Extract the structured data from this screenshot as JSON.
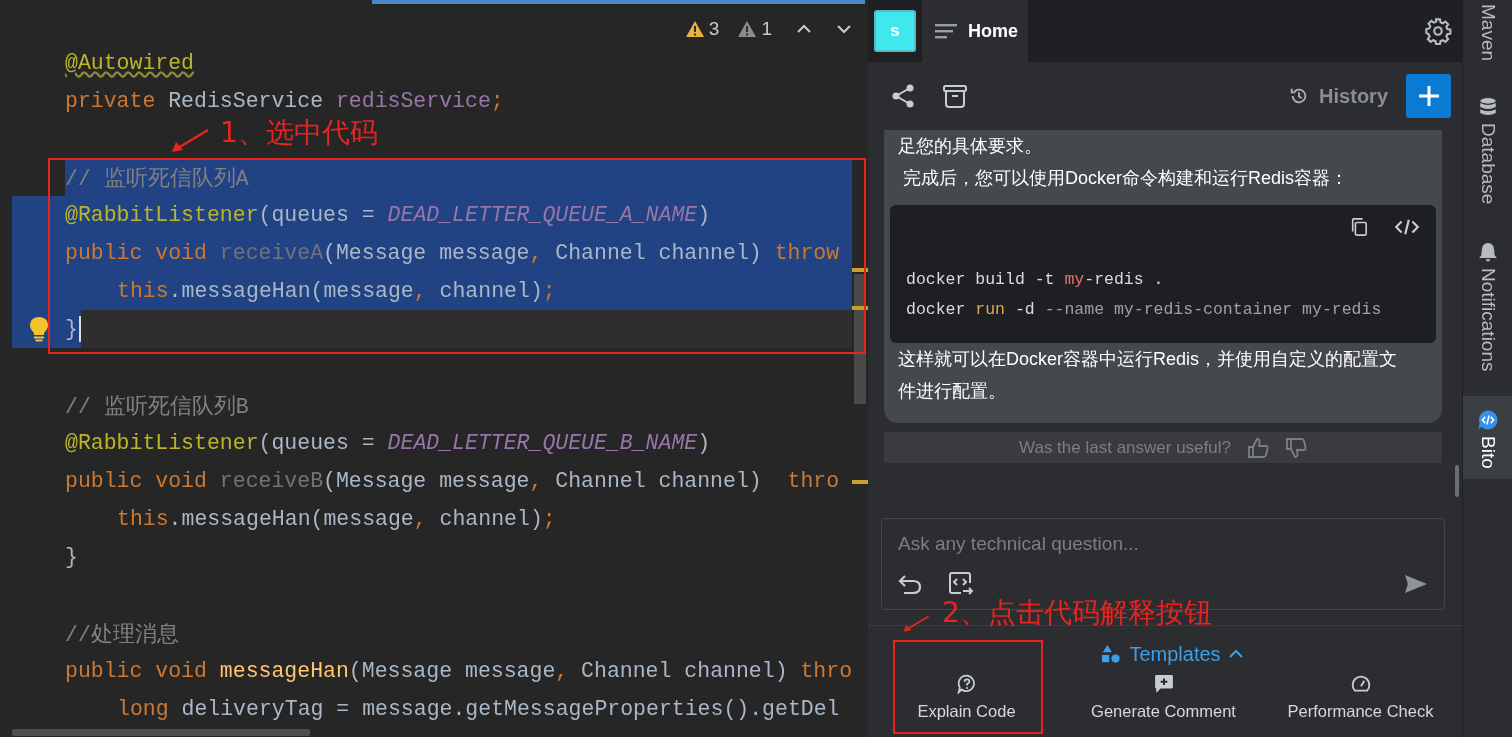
{
  "editor": {
    "inspections": [
      {
        "kind": "warning",
        "count": "3"
      },
      {
        "kind": "weak",
        "count": "1"
      }
    ],
    "lines": [
      {
        "kind": "top",
        "selected": false,
        "tokens": [
          {
            "kind": "annw",
            "t": "@Autowired"
          }
        ]
      },
      {
        "kind": "top",
        "selected": false,
        "tokens": [
          {
            "kind": "kw",
            "t": "private "
          },
          {
            "kind": "plain",
            "t": "RedisService "
          },
          {
            "kind": "field",
            "t": "redisService"
          },
          {
            "kind": "punct",
            "t": ";"
          }
        ]
      },
      {
        "kind": "blank",
        "selected": false
      },
      {
        "kind": "top",
        "selected": true,
        "tokens": [
          {
            "kind": "comment",
            "t": "// 监听死信队列A"
          }
        ]
      },
      {
        "kind": "top",
        "selected": true,
        "tokens": [
          {
            "kind": "ann",
            "t": "@RabbitListener"
          },
          {
            "kind": "plain",
            "t": "(queues = "
          },
          {
            "kind": "const",
            "t": "DEAD_LETTER_QUEUE_A_NAME"
          },
          {
            "kind": "plain",
            "t": ")"
          }
        ]
      },
      {
        "kind": "top",
        "selected": true,
        "tokens": [
          {
            "kind": "kw",
            "t": "public void "
          },
          {
            "kind": "unused",
            "t": "receiveA"
          },
          {
            "kind": "plain",
            "t": "(Message message"
          },
          {
            "kind": "punct",
            "t": ", "
          },
          {
            "kind": "plain",
            "t": "Channel channel) "
          },
          {
            "kind": "kw",
            "t": "throw"
          }
        ]
      },
      {
        "kind": "indented",
        "selected": true,
        "tokens": [
          {
            "kind": "kw",
            "t": "this"
          },
          {
            "kind": "plain",
            "t": ".messageHan(message"
          },
          {
            "kind": "punct",
            "t": ", "
          },
          {
            "kind": "plain",
            "t": "channel)"
          },
          {
            "kind": "punct",
            "t": ";"
          }
        ]
      },
      {
        "kind": "top",
        "selected": true,
        "caret": true,
        "lightbulb": true,
        "tokens": [
          {
            "kind": "plain",
            "t": "}"
          }
        ]
      },
      {
        "kind": "blank",
        "selected": false
      },
      {
        "kind": "top",
        "selected": false,
        "tokens": [
          {
            "kind": "comment",
            "t": "// 监听死信队列B"
          }
        ]
      },
      {
        "kind": "top",
        "selected": false,
        "tokens": [
          {
            "kind": "ann",
            "t": "@RabbitListener"
          },
          {
            "kind": "plain",
            "t": "(queues = "
          },
          {
            "kind": "const",
            "t": "DEAD_LETTER_QUEUE_B_NAME"
          },
          {
            "kind": "plain",
            "t": ")"
          }
        ]
      },
      {
        "kind": "top",
        "selected": false,
        "tokens": [
          {
            "kind": "kw",
            "t": "public void "
          },
          {
            "kind": "unused",
            "t": "receiveB"
          },
          {
            "kind": "plain",
            "t": "(Message message"
          },
          {
            "kind": "punct",
            "t": ", "
          },
          {
            "kind": "plain",
            "t": "Channel channel)  "
          },
          {
            "kind": "kw",
            "t": "thro"
          }
        ]
      },
      {
        "kind": "indented",
        "selected": false,
        "tokens": [
          {
            "kind": "kw",
            "t": "this"
          },
          {
            "kind": "plain",
            "t": ".messageHan(message"
          },
          {
            "kind": "punct",
            "t": ", "
          },
          {
            "kind": "plain",
            "t": "channel)"
          },
          {
            "kind": "punct",
            "t": ";"
          }
        ]
      },
      {
        "kind": "top",
        "selected": false,
        "tokens": [
          {
            "kind": "plain",
            "t": "}"
          }
        ]
      },
      {
        "kind": "blank",
        "selected": false
      },
      {
        "kind": "top",
        "selected": false,
        "tokens": [
          {
            "kind": "comment",
            "t": "//处理消息"
          }
        ]
      },
      {
        "kind": "top",
        "selected": false,
        "tokens": [
          {
            "kind": "kw",
            "t": "public void "
          },
          {
            "kind": "method",
            "t": "messageHan"
          },
          {
            "kind": "plain",
            "t": "(Message message"
          },
          {
            "kind": "punct",
            "t": ", "
          },
          {
            "kind": "plain",
            "t": "Channel channel) "
          },
          {
            "kind": "kw",
            "t": "thro"
          }
        ]
      },
      {
        "kind": "indented",
        "selected": false,
        "tokens": [
          {
            "kind": "kw",
            "t": "long "
          },
          {
            "kind": "plain",
            "t": "deliveryTag = message.getMessageProperties().getDel"
          }
        ]
      }
    ]
  },
  "bito": {
    "avatar": "s",
    "tab": "Home",
    "history": "History",
    "messages": [
      {
        "kind": "text",
        "text": "足您的具体要求。"
      },
      {
        "kind": "text",
        "text": " 完成后，您可以使用Docker命令构建和运行Redis容器："
      },
      {
        "kind": "code",
        "lines": [
          [
            {
              "kind": "plain",
              "t": "docker build -t "
            },
            {
              "kind": "name",
              "t": "my"
            },
            {
              "kind": "plain",
              "t": "-redis ."
            }
          ],
          [
            {
              "kind": "plain",
              "t": "docker "
            },
            {
              "kind": "kw",
              "t": "run"
            },
            {
              "kind": "plain",
              "t": " -d "
            },
            {
              "kind": "muted",
              "t": "--name my-redis-container my-redis"
            }
          ]
        ]
      },
      {
        "kind": "text",
        "text": "这样就可以在Docker容器中运行Redis，并使用自定义的配置文件进行配置。"
      }
    ],
    "feedback": "Was the last answer useful?",
    "input": {
      "placeholder": "Ask any technical question..."
    },
    "templates": {
      "label": "Templates",
      "expanded": true
    },
    "actions": [
      {
        "kind": "explain",
        "label": "Explain Code"
      },
      {
        "kind": "comment",
        "label": "Generate Comment"
      },
      {
        "kind": "performance",
        "label": "Performance Check"
      }
    ]
  },
  "tool_stripe": [
    {
      "kind": "plain",
      "label": "Maven",
      "selected": false
    },
    {
      "kind": "database",
      "label": "Database",
      "selected": false
    },
    {
      "kind": "bell",
      "label": "Notifications",
      "selected": false
    },
    {
      "kind": "bito",
      "label": "Bito",
      "selected": true
    }
  ],
  "annotations": [
    {
      "text": "1、选中代码"
    },
    {
      "text": "2、点击代码解释按钮"
    }
  ]
}
